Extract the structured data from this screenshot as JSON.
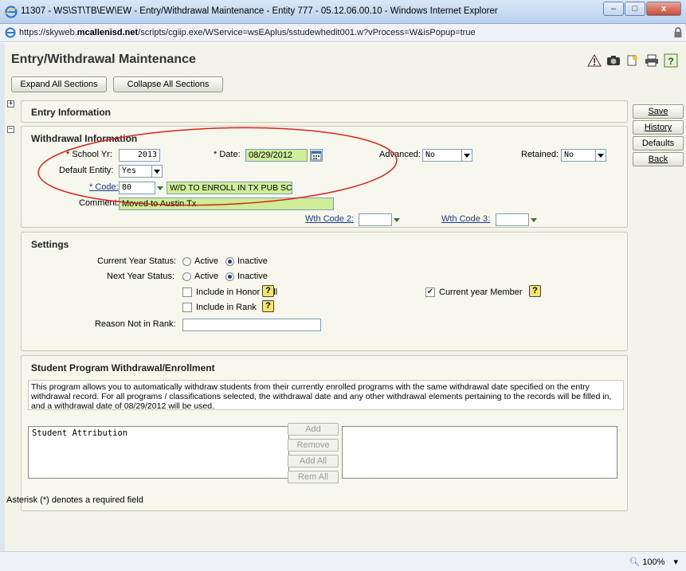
{
  "window": {
    "title": "11307 - WS\\ST\\TB\\EW\\EW - Entry/Withdrawal Maintenance - Entity 777 - 05.12.06.00.10 - Windows Internet Explorer",
    "minimize": "–",
    "maximize": "□",
    "close": "x"
  },
  "address": {
    "url_prefix": "https://skyweb.",
    "url_domain": "mcallenisd.net",
    "url_suffix": "/scripts/cgiip.exe/WService=wsEAplus/sstudewhedit001.w?vProcess=W&isPopup=true"
  },
  "page": {
    "title": "Entry/Withdrawal Maintenance",
    "expand_all": "Expand All Sections",
    "collapse_all": "Collapse All Sections"
  },
  "side_buttons": {
    "save": "Save",
    "history": "History",
    "defaults": "Defaults",
    "back": "Back"
  },
  "entry_section": {
    "title": "Entry Information",
    "toggle": "+"
  },
  "withdrawal": {
    "title": "Withdrawal Information",
    "toggle": "−",
    "school_yr_label": "* School Yr:",
    "school_yr_value": "2013",
    "date_label": "* Date:",
    "date_value": "08/29/2012",
    "advanced_label": "Advanced:",
    "advanced_value": "No",
    "retained_label": "Retained:",
    "retained_value": "No",
    "default_entity_label": "Default Entity:",
    "default_entity_value": "Yes",
    "code_label": "* Code:",
    "code_value": "80",
    "code_desc": "W/D TO ENROLL IN TX PUB SC",
    "comment_label": "Comment:",
    "comment_value": "Moved to Austin Tx",
    "wth_code2_label": "Wth Code 2:",
    "wth_code3_label": "Wth Code 3:"
  },
  "settings": {
    "title": "Settings",
    "current_year_status_label": "Current Year Status:",
    "next_year_status_label": "Next Year Status:",
    "active": "Active",
    "inactive": "Inactive",
    "current_year_status": "Inactive",
    "next_year_status": "Inactive",
    "honor_roll_label": "Include in Honor Roll",
    "honor_roll_checked": false,
    "rank_label": "Include in Rank",
    "rank_checked": false,
    "current_year_member_label": "Current year Member",
    "current_year_member_checked": true,
    "reason_label": "Reason Not in Rank:",
    "reason_value": "",
    "help_glyph": "?"
  },
  "program": {
    "title": "Student Program Withdrawal/Enrollment",
    "description": "This program allows you to automatically withdraw students from their currently enrolled programs with the same withdrawal date specified on the entry withdrawal record. For all programs / classifications selected, the withdrawal date and any other withdrawal elements pertaining to the records will be filled in, and a withdrawal date of 08/29/2012 will be used.",
    "left_list_items": [
      "Student Attribution"
    ],
    "add": "Add",
    "remove": "Remove",
    "add_all": "Add All",
    "rem_all": "Rem All"
  },
  "footer_note": "Asterisk (*) denotes a required field",
  "status": {
    "zoom": "100%",
    "zoom_caret": "▾"
  },
  "colors": {
    "annotation_ellipse": "#d8241c",
    "field_highlight": "#cfee9a",
    "panel_bg": "#f7f7ee"
  }
}
